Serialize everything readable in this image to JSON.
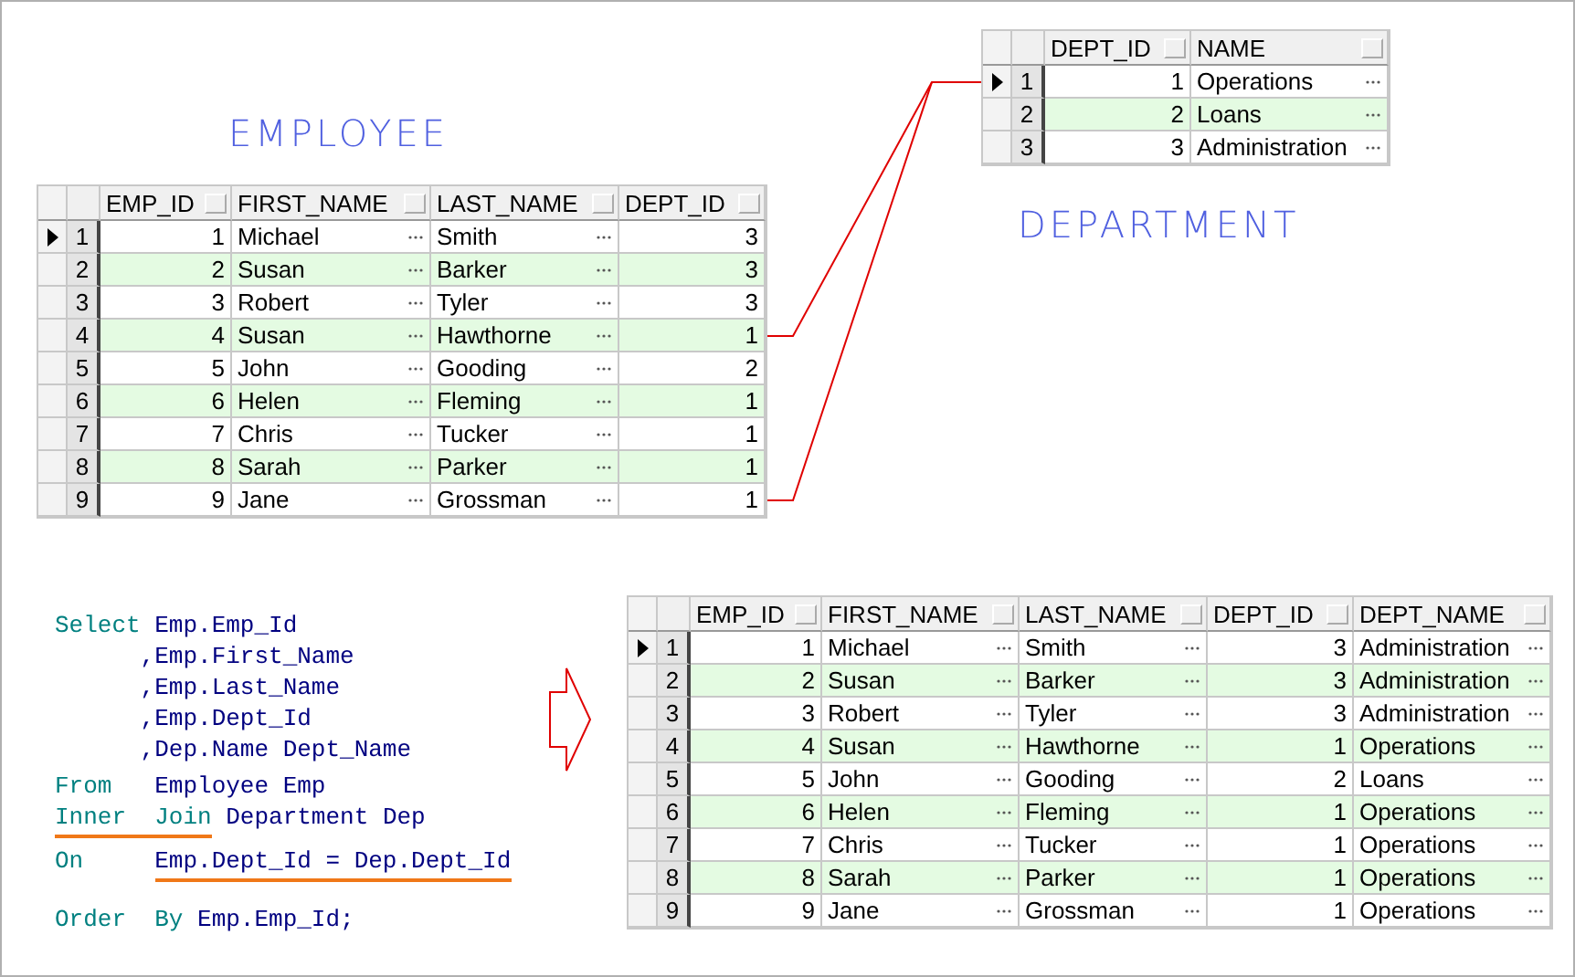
{
  "employee": {
    "title": "EMPLOYEE",
    "columns": [
      {
        "label": "EMP_ID",
        "kind": "number"
      },
      {
        "label": "FIRST_NAME",
        "kind": "text"
      },
      {
        "label": "LAST_NAME",
        "kind": "text"
      },
      {
        "label": "DEPT_ID",
        "kind": "number"
      }
    ],
    "rows": [
      {
        "number": "1",
        "current": true,
        "cells": [
          "1",
          "Michael",
          "Smith",
          "3"
        ]
      },
      {
        "number": "2",
        "current": false,
        "cells": [
          "2",
          "Susan",
          "Barker",
          "3"
        ]
      },
      {
        "number": "3",
        "current": false,
        "cells": [
          "3",
          "Robert",
          "Tyler",
          "3"
        ]
      },
      {
        "number": "4",
        "current": false,
        "cells": [
          "4",
          "Susan",
          "Hawthorne",
          "1"
        ]
      },
      {
        "number": "5",
        "current": false,
        "cells": [
          "5",
          "John",
          "Gooding",
          "2"
        ]
      },
      {
        "number": "6",
        "current": false,
        "cells": [
          "6",
          "Helen",
          "Fleming",
          "1"
        ]
      },
      {
        "number": "7",
        "current": false,
        "cells": [
          "7",
          "Chris",
          "Tucker",
          "1"
        ]
      },
      {
        "number": "8",
        "current": false,
        "cells": [
          "8",
          "Sarah",
          "Parker",
          "1"
        ]
      },
      {
        "number": "9",
        "current": false,
        "cells": [
          "9",
          "Jane",
          "Grossman",
          "1"
        ]
      }
    ]
  },
  "department": {
    "title": "DEPARTMENT",
    "columns": [
      {
        "label": "DEPT_ID",
        "kind": "number"
      },
      {
        "label": "NAME",
        "kind": "text"
      }
    ],
    "rows": [
      {
        "number": "1",
        "current": true,
        "cells": [
          "1",
          "Operations"
        ]
      },
      {
        "number": "2",
        "current": false,
        "cells": [
          "2",
          "Loans"
        ]
      },
      {
        "number": "3",
        "current": false,
        "cells": [
          "3",
          "Administration"
        ]
      }
    ]
  },
  "query": {
    "lines": [
      [
        {
          "text": "Select ",
          "kind": "keyword",
          "highlighted": false
        },
        {
          "text": "Emp.Emp_Id",
          "kind": "identifier",
          "highlighted": false
        }
      ],
      [
        {
          "text": "      ,Emp.First_Name",
          "kind": "identifier",
          "highlighted": false
        }
      ],
      [
        {
          "text": "      ,Emp.Last_Name",
          "kind": "identifier",
          "highlighted": false
        }
      ],
      [
        {
          "text": "      ,Emp.Dept_Id",
          "kind": "identifier",
          "highlighted": false
        }
      ],
      [
        {
          "text": "      ,Dep.Name Dept_Name",
          "kind": "identifier",
          "highlighted": false
        }
      ],
      [
        {
          "text": "From   ",
          "kind": "keyword",
          "highlighted": false
        },
        {
          "text": "Employee Emp",
          "kind": "identifier",
          "highlighted": false
        }
      ],
      [
        {
          "text": "Inner  Join",
          "kind": "keyword",
          "highlighted": true
        },
        {
          "text": " Department Dep",
          "kind": "identifier",
          "highlighted": false
        }
      ],
      [
        {
          "text": "On     ",
          "kind": "keyword",
          "highlighted": false
        },
        {
          "text": "Emp.Dept_Id = Dep.Dept_Id",
          "kind": "identifier",
          "highlighted": true
        }
      ],
      [
        {
          "text": "Order  By",
          "kind": "keyword",
          "highlighted": false
        },
        {
          "text": " Emp.Emp_Id;",
          "kind": "identifier",
          "highlighted": false
        }
      ]
    ]
  },
  "result": {
    "columns": [
      {
        "label": "EMP_ID",
        "kind": "number"
      },
      {
        "label": "FIRST_NAME",
        "kind": "text"
      },
      {
        "label": "LAST_NAME",
        "kind": "text"
      },
      {
        "label": "DEPT_ID",
        "kind": "number"
      },
      {
        "label": "DEPT_NAME",
        "kind": "text"
      }
    ],
    "rows": [
      {
        "number": "1",
        "current": true,
        "cells": [
          "1",
          "Michael",
          "Smith",
          "3",
          "Administration"
        ]
      },
      {
        "number": "2",
        "current": false,
        "cells": [
          "2",
          "Susan",
          "Barker",
          "3",
          "Administration"
        ]
      },
      {
        "number": "3",
        "current": false,
        "cells": [
          "3",
          "Robert",
          "Tyler",
          "3",
          "Administration"
        ]
      },
      {
        "number": "4",
        "current": false,
        "cells": [
          "4",
          "Susan",
          "Hawthorne",
          "1",
          "Operations"
        ]
      },
      {
        "number": "5",
        "current": false,
        "cells": [
          "5",
          "John",
          "Gooding",
          "2",
          "Loans"
        ]
      },
      {
        "number": "6",
        "current": false,
        "cells": [
          "6",
          "Helen",
          "Fleming",
          "1",
          "Operations"
        ]
      },
      {
        "number": "7",
        "current": false,
        "cells": [
          "7",
          "Chris",
          "Tucker",
          "1",
          "Operations"
        ]
      },
      {
        "number": "8",
        "current": false,
        "cells": [
          "8",
          "Sarah",
          "Parker",
          "1",
          "Operations"
        ]
      },
      {
        "number": "9",
        "current": false,
        "cells": [
          "9",
          "Jane",
          "Grossman",
          "1",
          "Operations"
        ]
      }
    ]
  }
}
